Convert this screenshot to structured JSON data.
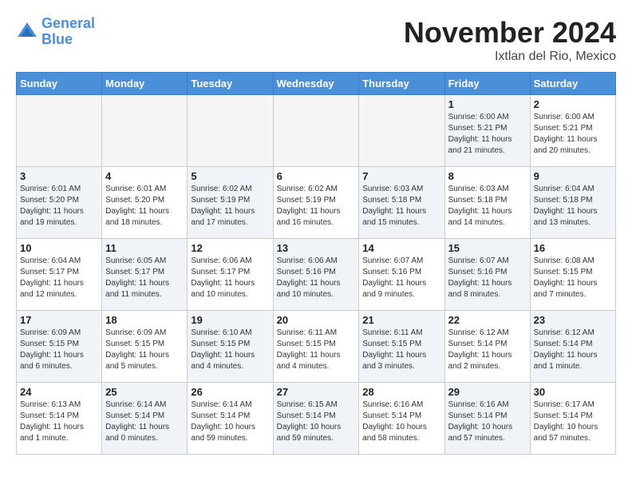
{
  "logo": {
    "line1": "General",
    "line2": "Blue"
  },
  "header": {
    "month": "November 2024",
    "location": "Ixtlan del Rio, Mexico"
  },
  "weekdays": [
    "Sunday",
    "Monday",
    "Tuesday",
    "Wednesday",
    "Thursday",
    "Friday",
    "Saturday"
  ],
  "weeks": [
    [
      {
        "day": "",
        "info": "",
        "empty": true
      },
      {
        "day": "",
        "info": "",
        "empty": true
      },
      {
        "day": "",
        "info": "",
        "empty": true
      },
      {
        "day": "",
        "info": "",
        "empty": true
      },
      {
        "day": "",
        "info": "",
        "empty": true
      },
      {
        "day": "1",
        "info": "Sunrise: 6:00 AM\nSunset: 5:21 PM\nDaylight: 11 hours and 21 minutes.",
        "shaded": true
      },
      {
        "day": "2",
        "info": "Sunrise: 6:00 AM\nSunset: 5:21 PM\nDaylight: 11 hours and 20 minutes.",
        "shaded": false
      }
    ],
    [
      {
        "day": "3",
        "info": "Sunrise: 6:01 AM\nSunset: 5:20 PM\nDaylight: 11 hours and 19 minutes.",
        "shaded": true
      },
      {
        "day": "4",
        "info": "Sunrise: 6:01 AM\nSunset: 5:20 PM\nDaylight: 11 hours and 18 minutes.",
        "shaded": false
      },
      {
        "day": "5",
        "info": "Sunrise: 6:02 AM\nSunset: 5:19 PM\nDaylight: 11 hours and 17 minutes.",
        "shaded": true
      },
      {
        "day": "6",
        "info": "Sunrise: 6:02 AM\nSunset: 5:19 PM\nDaylight: 11 hours and 16 minutes.",
        "shaded": false
      },
      {
        "day": "7",
        "info": "Sunrise: 6:03 AM\nSunset: 5:18 PM\nDaylight: 11 hours and 15 minutes.",
        "shaded": true
      },
      {
        "day": "8",
        "info": "Sunrise: 6:03 AM\nSunset: 5:18 PM\nDaylight: 11 hours and 14 minutes.",
        "shaded": false
      },
      {
        "day": "9",
        "info": "Sunrise: 6:04 AM\nSunset: 5:18 PM\nDaylight: 11 hours and 13 minutes.",
        "shaded": true
      }
    ],
    [
      {
        "day": "10",
        "info": "Sunrise: 6:04 AM\nSunset: 5:17 PM\nDaylight: 11 hours and 12 minutes.",
        "shaded": false
      },
      {
        "day": "11",
        "info": "Sunrise: 6:05 AM\nSunset: 5:17 PM\nDaylight: 11 hours and 11 minutes.",
        "shaded": true
      },
      {
        "day": "12",
        "info": "Sunrise: 6:06 AM\nSunset: 5:17 PM\nDaylight: 11 hours and 10 minutes.",
        "shaded": false
      },
      {
        "day": "13",
        "info": "Sunrise: 6:06 AM\nSunset: 5:16 PM\nDaylight: 11 hours and 10 minutes.",
        "shaded": true
      },
      {
        "day": "14",
        "info": "Sunrise: 6:07 AM\nSunset: 5:16 PM\nDaylight: 11 hours and 9 minutes.",
        "shaded": false
      },
      {
        "day": "15",
        "info": "Sunrise: 6:07 AM\nSunset: 5:16 PM\nDaylight: 11 hours and 8 minutes.",
        "shaded": true
      },
      {
        "day": "16",
        "info": "Sunrise: 6:08 AM\nSunset: 5:15 PM\nDaylight: 11 hours and 7 minutes.",
        "shaded": false
      }
    ],
    [
      {
        "day": "17",
        "info": "Sunrise: 6:09 AM\nSunset: 5:15 PM\nDaylight: 11 hours and 6 minutes.",
        "shaded": true
      },
      {
        "day": "18",
        "info": "Sunrise: 6:09 AM\nSunset: 5:15 PM\nDaylight: 11 hours and 5 minutes.",
        "shaded": false
      },
      {
        "day": "19",
        "info": "Sunrise: 6:10 AM\nSunset: 5:15 PM\nDaylight: 11 hours and 4 minutes.",
        "shaded": true
      },
      {
        "day": "20",
        "info": "Sunrise: 6:11 AM\nSunset: 5:15 PM\nDaylight: 11 hours and 4 minutes.",
        "shaded": false
      },
      {
        "day": "21",
        "info": "Sunrise: 6:11 AM\nSunset: 5:15 PM\nDaylight: 11 hours and 3 minutes.",
        "shaded": true
      },
      {
        "day": "22",
        "info": "Sunrise: 6:12 AM\nSunset: 5:14 PM\nDaylight: 11 hours and 2 minutes.",
        "shaded": false
      },
      {
        "day": "23",
        "info": "Sunrise: 6:12 AM\nSunset: 5:14 PM\nDaylight: 11 hours and 1 minute.",
        "shaded": true
      }
    ],
    [
      {
        "day": "24",
        "info": "Sunrise: 6:13 AM\nSunset: 5:14 PM\nDaylight: 11 hours and 1 minute.",
        "shaded": false
      },
      {
        "day": "25",
        "info": "Sunrise: 6:14 AM\nSunset: 5:14 PM\nDaylight: 11 hours and 0 minutes.",
        "shaded": true
      },
      {
        "day": "26",
        "info": "Sunrise: 6:14 AM\nSunset: 5:14 PM\nDaylight: 10 hours and 59 minutes.",
        "shaded": false
      },
      {
        "day": "27",
        "info": "Sunrise: 6:15 AM\nSunset: 5:14 PM\nDaylight: 10 hours and 59 minutes.",
        "shaded": true
      },
      {
        "day": "28",
        "info": "Sunrise: 6:16 AM\nSunset: 5:14 PM\nDaylight: 10 hours and 58 minutes.",
        "shaded": false
      },
      {
        "day": "29",
        "info": "Sunrise: 6:16 AM\nSunset: 5:14 PM\nDaylight: 10 hours and 57 minutes.",
        "shaded": true
      },
      {
        "day": "30",
        "info": "Sunrise: 6:17 AM\nSunset: 5:14 PM\nDaylight: 10 hours and 57 minutes.",
        "shaded": false
      }
    ]
  ]
}
